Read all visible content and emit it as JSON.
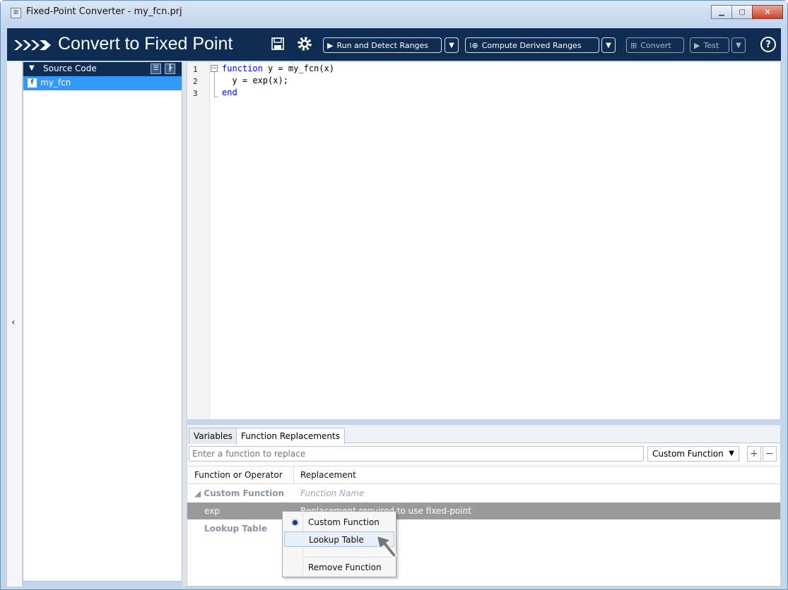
{
  "window": {
    "title": "Fixed-Point Converter - my_fcn.prj",
    "minimize_icon": "minimize-icon",
    "maximize_icon": "maximize-icon",
    "close_icon": "close-icon"
  },
  "toolbar": {
    "title": "Convert to Fixed Point",
    "save_icon": "save-icon",
    "settings_icon": "gear-icon",
    "run_label": "Run and Detect Ranges",
    "compute_label": "Compute Derived Ranges",
    "convert_label": "Convert",
    "test_label": "Test",
    "help_icon": "help-icon"
  },
  "sidebar": {
    "header": "Source Code",
    "files": [
      "my_fcn"
    ]
  },
  "editor": {
    "lines": [
      {
        "num": "1",
        "keyword": "function",
        "rest": " y = my_fcn(x)"
      },
      {
        "num": "2",
        "keyword": "",
        "rest": "  y = exp(x);"
      },
      {
        "num": "3",
        "keyword": "end",
        "rest": ""
      }
    ]
  },
  "bottom": {
    "tabs": [
      "Variables",
      "Function Replacements"
    ],
    "active_tab": "Function Replacements",
    "input_placeholder": "Enter a function to replace",
    "select_value": "Custom Function",
    "add_label": "+",
    "remove_label": "−",
    "columns": [
      "Function or Operator",
      "Replacement"
    ],
    "rows": {
      "group1": "Custom Function",
      "group1_placeholder": "Function Name",
      "exp_name": "exp",
      "exp_replacement": "Replacement required to use fixed-point",
      "group2": "Lookup Table"
    }
  },
  "context_menu": {
    "items": [
      "Custom Function",
      "Lookup Table",
      "Remove Function"
    ],
    "selected": "Custom Function",
    "hovered": "Lookup Table"
  }
}
